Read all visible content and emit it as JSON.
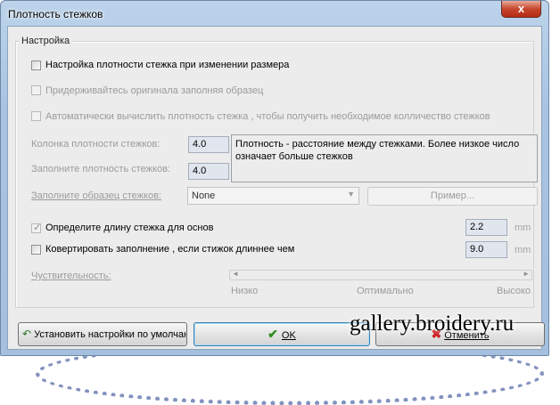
{
  "window": {
    "title": "Плотность стежков",
    "close_glyph": "x"
  },
  "group": {
    "title": "Настройка"
  },
  "options": {
    "adjust_density": {
      "label": "Настройка плотности стежка при изменении размера",
      "checked": false
    },
    "keep_original": {
      "label": "Придерживайтесь оригинала заполняя образец",
      "checked": false
    },
    "auto_calc": {
      "label": "Автоматически вычислить плотность стежка , чтобы получить необходимое колличество стежков",
      "checked": false
    }
  },
  "density": {
    "column_label": "Колонка плотности стежков:",
    "column_value": "4.0",
    "fill_label": "Заполните плотность стежков:",
    "fill_value": "4.0",
    "description": "Плотность - расстояние между стежками. Более низкое число означает больше стежков"
  },
  "pattern": {
    "label": "Заполните образец  стежков:",
    "selected": "None",
    "example_button": "Пример..."
  },
  "stitch_length": {
    "label": "Определите длину стежка для основ",
    "checked": true,
    "value": "2.2",
    "unit": "mm"
  },
  "convert": {
    "label": "Ковертировать  заполнение , если стижок длиннее чем",
    "checked": false,
    "value": "9.0",
    "unit": "mm"
  },
  "sensitivity": {
    "label": "Чуствительность:",
    "low": "Низко",
    "optimal": "Оптимально",
    "high": "Высоко"
  },
  "buttons": {
    "defaults": "Установить настройки по умолчан",
    "ok": "OK",
    "cancel": "Отменить"
  },
  "watermark": "gallery.broidery.ru"
}
